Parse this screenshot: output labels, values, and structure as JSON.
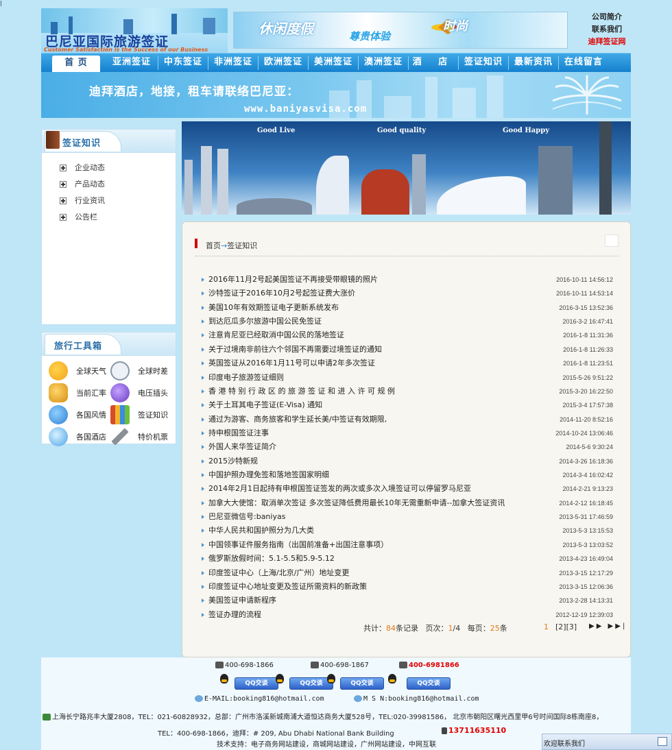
{
  "corner_mark": "|",
  "header": {
    "logo_cn": "巴尼亚国际旅游签证",
    "logo_en": "Customer Satisfaction is the Success of our Business",
    "banner_t1": "休闲度假",
    "banner_t2": "尊贵体验",
    "banner_t3": "时尚",
    "links": [
      {
        "label": "公司简介"
      },
      {
        "label": "联系我们"
      },
      {
        "label": "迪拜签证网"
      }
    ]
  },
  "nav": {
    "items": [
      {
        "label": "首 页"
      },
      {
        "label": "亚洲签证"
      },
      {
        "label": "中东签证"
      },
      {
        "label": "非洲签证"
      },
      {
        "label": "欧洲签证"
      },
      {
        "label": "美洲签证"
      },
      {
        "label": "澳洲签证"
      },
      {
        "label": "酒  店"
      },
      {
        "label": "签证知识"
      },
      {
        "label": "最新资讯"
      },
      {
        "label": "在线留言"
      }
    ]
  },
  "banner2": {
    "line1": "迪拜酒店，地接，租车请联络巴尼亚：",
    "line2": "www.baniyasvisa.com"
  },
  "sidebar": {
    "category_title": "签证知识",
    "categories": [
      "企业动态",
      "产品动态",
      "行业资讯",
      "公告栏"
    ],
    "tools_title": "旅行工具箱",
    "tools": [
      {
        "label": "全球天气",
        "icon": "weather-icon",
        "color": "#f3a21b"
      },
      {
        "label": "全球时差",
        "icon": "clock-icon",
        "color": "#d7dde6"
      },
      {
        "label": "当前汇率",
        "icon": "coins-icon",
        "color": "#e4a21a"
      },
      {
        "label": "电压插头",
        "icon": "plug-icon",
        "color": "#7a4bd0"
      },
      {
        "label": "各国风情",
        "icon": "globe-icon",
        "color": "#2f7fd3"
      },
      {
        "label": "签证知识",
        "icon": "books-icon",
        "color": "#d94a2a"
      },
      {
        "label": "各国酒店",
        "icon": "earth-icon",
        "color": "#4aa3e8"
      },
      {
        "label": "特价机票",
        "icon": "airplane-icon",
        "color": "#8b8f96"
      }
    ]
  },
  "slideshow": {
    "taglines": [
      "Good Live",
      "Good quality",
      "Good Happy"
    ]
  },
  "content": {
    "breadcrumb_home": "首页",
    "breadcrumb_arrow": "→",
    "breadcrumb_current": "签证知识",
    "news": [
      {
        "title": "2016年11月2号起美国签证不再接受带眼镜的照片",
        "date": "2016-10-11 14:56:12"
      },
      {
        "title": "沙特签证于2016年10月2号起签证费大涨价",
        "date": "2016-10-11 14:53:14"
      },
      {
        "title": "美国10年有效期签证电子更新系统发布",
        "date": "2016-3-15 13:52:36"
      },
      {
        "title": "到达厄瓜多尔旅游中国公民免签证",
        "date": "2016-3-2 16:47:41"
      },
      {
        "title": "注意肯尼亚已经取消中国公民的落地签证",
        "date": "2016-1-8 11:31:36"
      },
      {
        "title": "关于过境南非前往六个邻国不再需要过境签证的通知",
        "date": "2016-1-8 11:26:33"
      },
      {
        "title": "英国签证从2016年1月11号可以申请2年多次签证",
        "date": "2016-1-8 11:23:51"
      },
      {
        "title": "印度电子旅游签证细则",
        "date": "2015-5-26 9:51:22"
      },
      {
        "title": "香 港 特 别 行 政 区 的 旅 游 签 证 和 进 入 许 可 规 例",
        "date": "2015-3-20 16:22:50"
      },
      {
        "title": "关于土耳其电子签证(E-Visa) 通知",
        "date": "2015-3-4 17:57:38"
      },
      {
        "title": "通过为游客、商务旅客和学生延长美/中签证有效期限,",
        "date": "2014-11-20 8:52:16"
      },
      {
        "title": "持申根国签证注事",
        "date": "2014-10-24 13:06:46"
      },
      {
        "title": "外国人来华签证简介",
        "date": "2014-5-6 9:30:24"
      },
      {
        "title": "2015沙特新规",
        "date": "2014-3-26 16:18:36"
      },
      {
        "title": "中国护照办理免签和落地签国家明细",
        "date": "2014-3-4 16:02:42"
      },
      {
        "title": "2014年2月1日起持有申根国签证签发的两次或多次入境签证可以停留罗马尼亚",
        "date": "2014-2-21 9:13:23"
      },
      {
        "title": "加拿大大使馆：取消单次签证 多次签证降低费用最长10年无需重新申请--加拿大签证资讯",
        "date": "2014-2-12 16:18:45"
      },
      {
        "title": "巴尼亚微信号:baniyas",
        "date": "2013-5-31 17:46:59"
      },
      {
        "title": "中华人民共和国护照分为几大类",
        "date": "2013-5-3 13:15:53"
      },
      {
        "title": "中国领事证件服务指南（出国前准备+出国注意事项）",
        "date": "2013-5-3 13:03:52"
      },
      {
        "title": "俄罗斯放假时间：5.1-5.5和5.9-5.12",
        "date": "2013-4-23 16:49:04"
      },
      {
        "title": "印度签证中心（上海/北京/广州）地址变更",
        "date": "2013-3-15 12:17:29"
      },
      {
        "title": "印度签证中心地址变更及签证所需资料的新政策",
        "date": "2013-3-15 12:06:36"
      },
      {
        "title": "美国签证申请新程序",
        "date": "2013-2-28 14:13:31"
      },
      {
        "title": "签证办理的流程",
        "date": "2012-12-19 12:39:03"
      }
    ],
    "pager": {
      "total_label": "共计：",
      "total": "84",
      "total_unit": "条记录",
      "page_label": "页次：",
      "page": "1",
      "page_sep": "/4",
      "per_label": "每页：",
      "per": "25",
      "per_unit": "条",
      "current_page": "1",
      "other_pages": "[2][3]",
      "next_arrows": "▶▶ ▶▶|"
    }
  },
  "footer": {
    "phone1": "400-698-1866",
    "phone2": "400-698-1867",
    "phone3": "400-6981866",
    "qq_label": "QQ交谈",
    "email": "E-MAIL:booking816@hotmail.com",
    "msn": "M S N:booking816@hotmail.com",
    "address": "上海长宁路兆丰大厦2808，TEL：021-60828932，总部：广州市洛溪新城南浦大道恒达商务大厦528号，TEL:020-39981586， 北京市朝阳区曙光西里甲6号时间国际8栋南座8，",
    "dubai": "TEL：400-698-1866，迪拜：# 209, Abu Dhabi National Bank Building",
    "mobile": "13711635110",
    "tech": "技术支持：电子商务网站建设，商城网站建设，广州网站建设，中网互联",
    "welcome": "欢迎联系我们"
  }
}
